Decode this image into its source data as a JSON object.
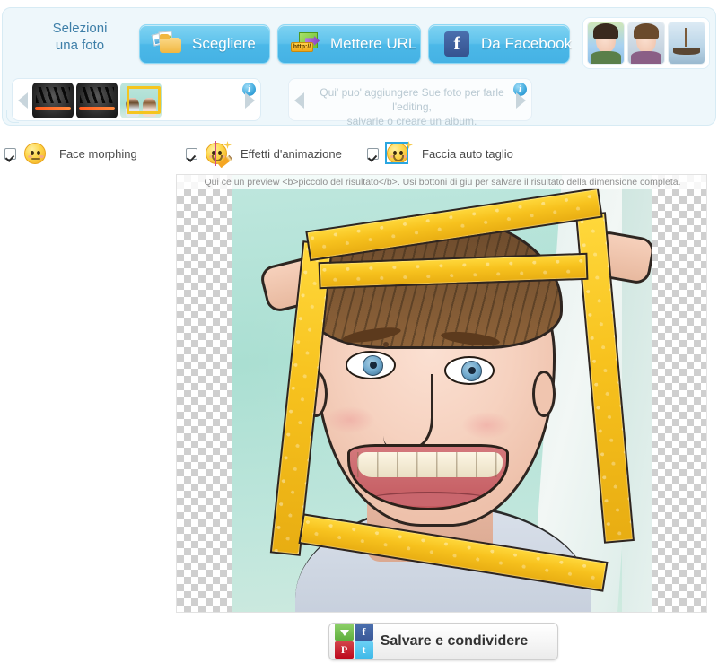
{
  "toolbar": {
    "select_photo_label": "Selezioni\nuna foto",
    "select_photo_line1": "Selezioni",
    "select_photo_line2": "una foto",
    "buttons": [
      {
        "id": "choose",
        "label": "Scegliere",
        "icon": "folder-photos-icon"
      },
      {
        "id": "url",
        "label": "Mettere URL",
        "icon": "url-arrow-icon",
        "icon_text": "http://"
      },
      {
        "id": "facebook",
        "label": "Da Facebook",
        "icon": "facebook-icon",
        "icon_glyph": "f"
      }
    ],
    "samples": [
      {
        "id": "sample-girl",
        "name": "sample-photo-girl"
      },
      {
        "id": "sample-boy",
        "name": "sample-photo-boy"
      },
      {
        "id": "sample-boat",
        "name": "sample-photo-boat"
      }
    ]
  },
  "strips": {
    "left": {
      "thumbs": [
        {
          "id": "thumb-1",
          "style": "dark"
        },
        {
          "id": "thumb-2",
          "style": "dark"
        },
        {
          "id": "thumb-3",
          "style": "frame"
        }
      ],
      "info_glyph": "i",
      "prev_label": "◀",
      "next_label": "▶"
    },
    "right": {
      "hint_line1": "Qui' puo' aggiungere Sue foto per farle l'editing,",
      "hint_line2": "salvarle o creare un album.",
      "info_glyph": "i",
      "prev_label": "◀",
      "next_label": "▶"
    }
  },
  "options": [
    {
      "id": "face-morphing",
      "label": "Face morphing",
      "checked": true,
      "icon": "smiley-neutral-icon"
    },
    {
      "id": "animation-effects",
      "label": "Effetti d'animazione",
      "checked": true,
      "icon": "smiley-pencil-icon"
    },
    {
      "id": "face-auto-crop",
      "label": "Faccia auto taglio",
      "checked": true,
      "icon": "smiley-crop-icon"
    }
  ],
  "preview": {
    "caption": "Qui ce un preview <b>piccolo del risultato</b>. Usi bottoni di giu per salvare il risultato della dimensione completa.",
    "alt": "Anteprima cartoon: ragazzo sorridente con cornice gialla"
  },
  "save": {
    "label": "Salvare e condividere",
    "share_icons": [
      {
        "id": "download",
        "name": "download-icon",
        "glyph": ""
      },
      {
        "id": "facebook",
        "name": "facebook-icon",
        "glyph": "f"
      },
      {
        "id": "pinterest",
        "name": "pinterest-icon",
        "glyph": "P"
      },
      {
        "id": "twitter",
        "name": "twitter-icon",
        "glyph": "t"
      }
    ]
  },
  "colors": {
    "panel_bg": "#eef7fb",
    "button_blue": "#4bb8e8",
    "label_blue": "#3e7fa8",
    "hint_gray": "#b9c9d2",
    "caption_gray": "#8e8e8e"
  }
}
